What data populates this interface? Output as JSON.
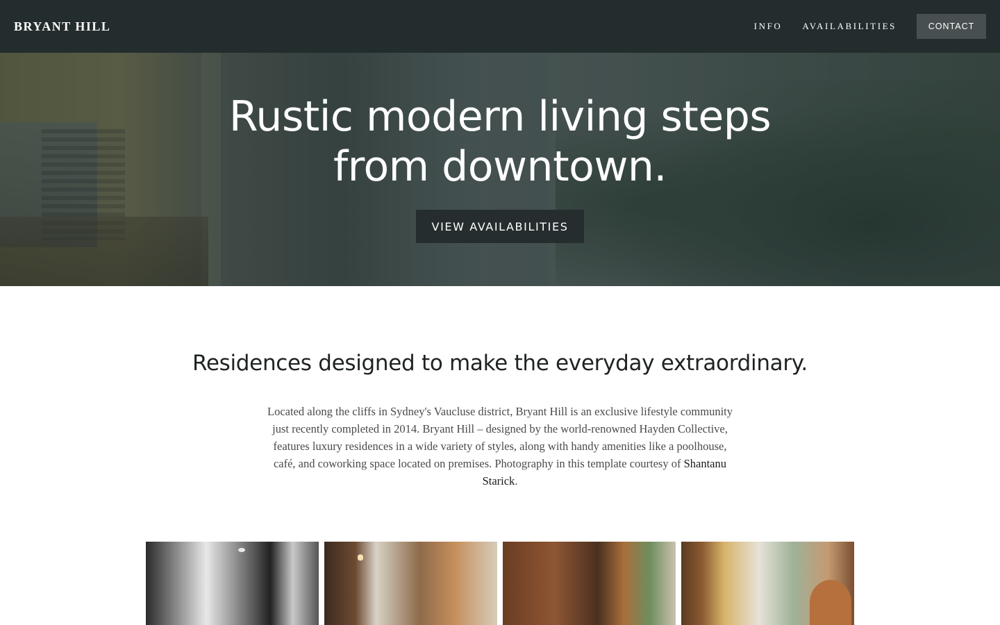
{
  "header": {
    "logo": "BRYANT HILL",
    "nav": [
      {
        "label": "INFO"
      },
      {
        "label": "AVAILABILITIES"
      }
    ],
    "contact_label": "CONTACT"
  },
  "hero": {
    "title_line1": "Rustic modern living steps",
    "title_line2": "from downtown.",
    "button_label": "VIEW AVAILABILITIES"
  },
  "intro": {
    "heading": "Residences designed to make the everyday extraordinary.",
    "body": "Located along the cliffs in Sydney's Vaucluse district, Bryant Hill is an exclusive lifestyle community just recently completed in 2014. Bryant Hill – designed by the world-renowned Hayden Collective, features luxury residences in a wide variety of styles, along with handy amenities like a poolhouse, café, and coworking space located on premises. Photography in this template courtesy of ",
    "link": "Shantanu Starick",
    "trailing": "."
  },
  "colors": {
    "header_bg": "#242d2e",
    "contact_bg": "#474f50",
    "hero_button_bg": "#252d2e"
  }
}
